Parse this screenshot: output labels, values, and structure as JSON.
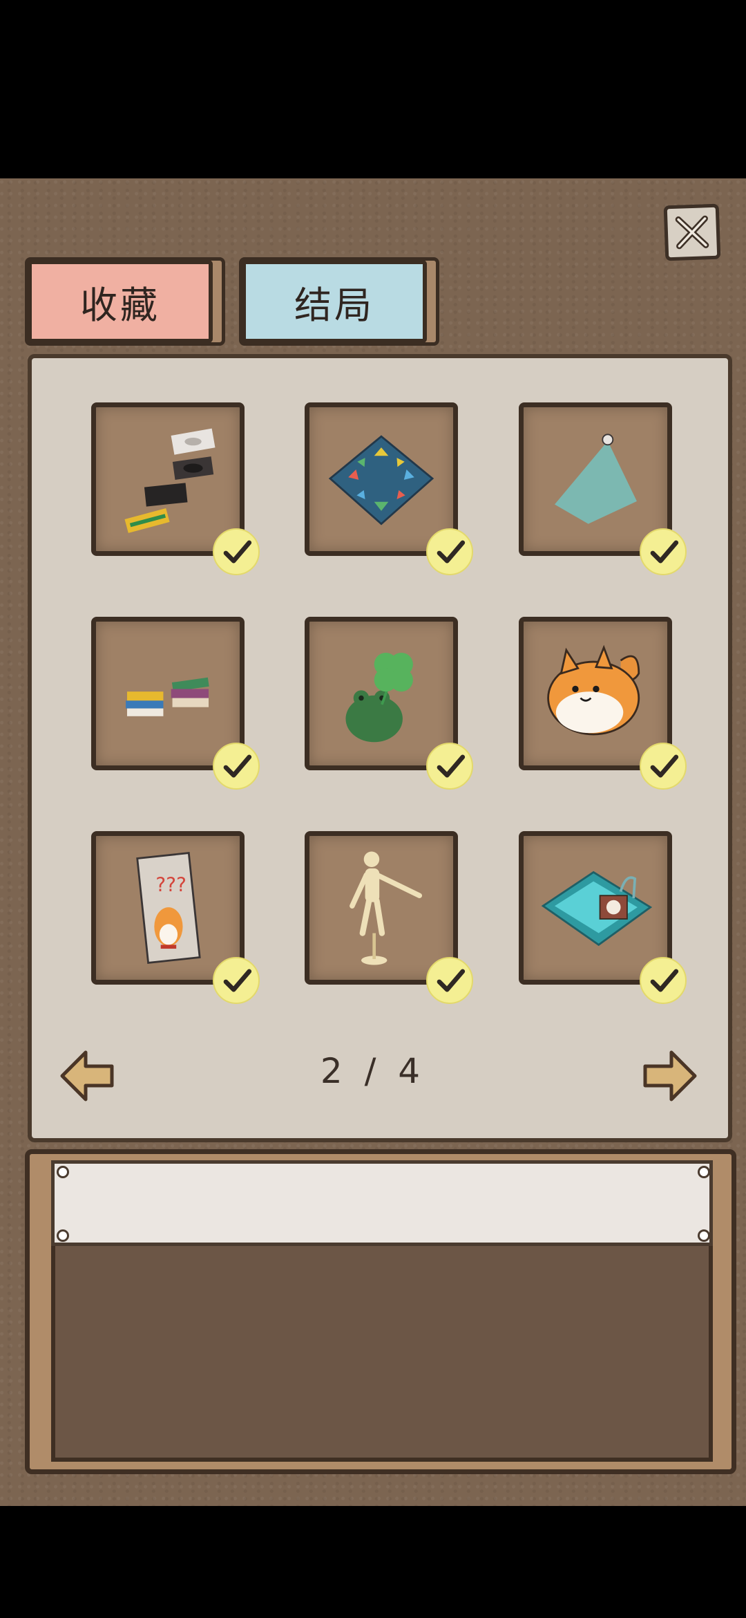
{
  "tabs": [
    {
      "label": "收藏",
      "color": "#f0b0a2",
      "active": true
    },
    {
      "label": "结局",
      "color": "#b9dbe3",
      "active": false
    }
  ],
  "close_icon": "close-icon",
  "items": [
    {
      "icon": "cd-records-books-icon",
      "collected": true
    },
    {
      "icon": "arrow-rug-icon",
      "collected": true
    },
    {
      "icon": "spotlight-icon",
      "collected": true
    },
    {
      "icon": "stacked-books-icon",
      "collected": true
    },
    {
      "icon": "frog-clover-icon",
      "collected": true
    },
    {
      "icon": "corgi-plush-icon",
      "collected": true
    },
    {
      "icon": "corgi-poster-icon",
      "collected": true
    },
    {
      "icon": "wooden-mannequin-icon",
      "collected": true
    },
    {
      "icon": "sink-clock-icon",
      "collected": true
    }
  ],
  "poster_text": "???",
  "pagination": {
    "label": "2 / 4",
    "current": 2,
    "total": 4
  },
  "detail": {
    "title": "",
    "description": ""
  },
  "colors": {
    "check": "#f4ef93",
    "frame": "#3c2e23",
    "tile": "#9f8166"
  }
}
